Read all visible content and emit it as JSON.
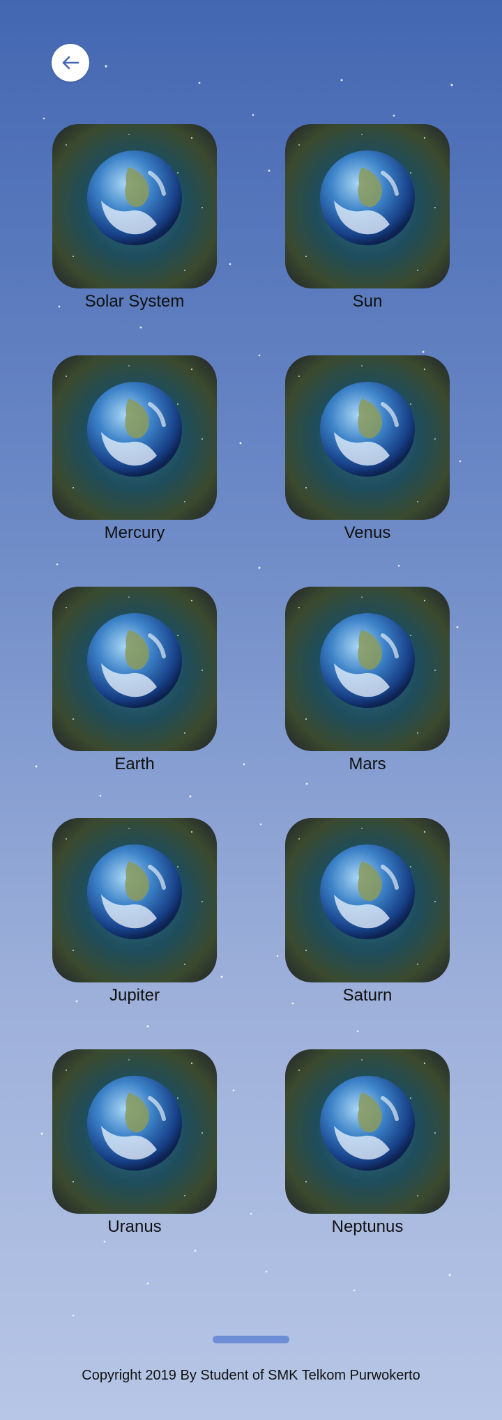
{
  "back_button": {
    "icon": "arrow-left-icon",
    "color": "#4467b2"
  },
  "planets": [
    {
      "label": "Solar System",
      "icon": "planet-earth-icon"
    },
    {
      "label": "Sun",
      "icon": "planet-earth-icon"
    },
    {
      "label": "Mercury",
      "icon": "planet-earth-icon"
    },
    {
      "label": "Venus",
      "icon": "planet-earth-icon"
    },
    {
      "label": "Earth",
      "icon": "planet-earth-icon"
    },
    {
      "label": "Mars",
      "icon": "planet-earth-icon"
    },
    {
      "label": "Jupiter",
      "icon": "planet-earth-icon"
    },
    {
      "label": "Saturn",
      "icon": "planet-earth-icon"
    },
    {
      "label": "Uranus",
      "icon": "planet-earth-icon"
    },
    {
      "label": "Neptunus",
      "icon": "planet-earth-icon"
    }
  ],
  "footer": {
    "copyright": "Copyright 2019 By Student of SMK Telkom Purwokerto"
  },
  "colors": {
    "background_top": "#4467b2",
    "background_bottom": "#b7c6e6",
    "scroll_indicator": "#6d8ed6"
  }
}
